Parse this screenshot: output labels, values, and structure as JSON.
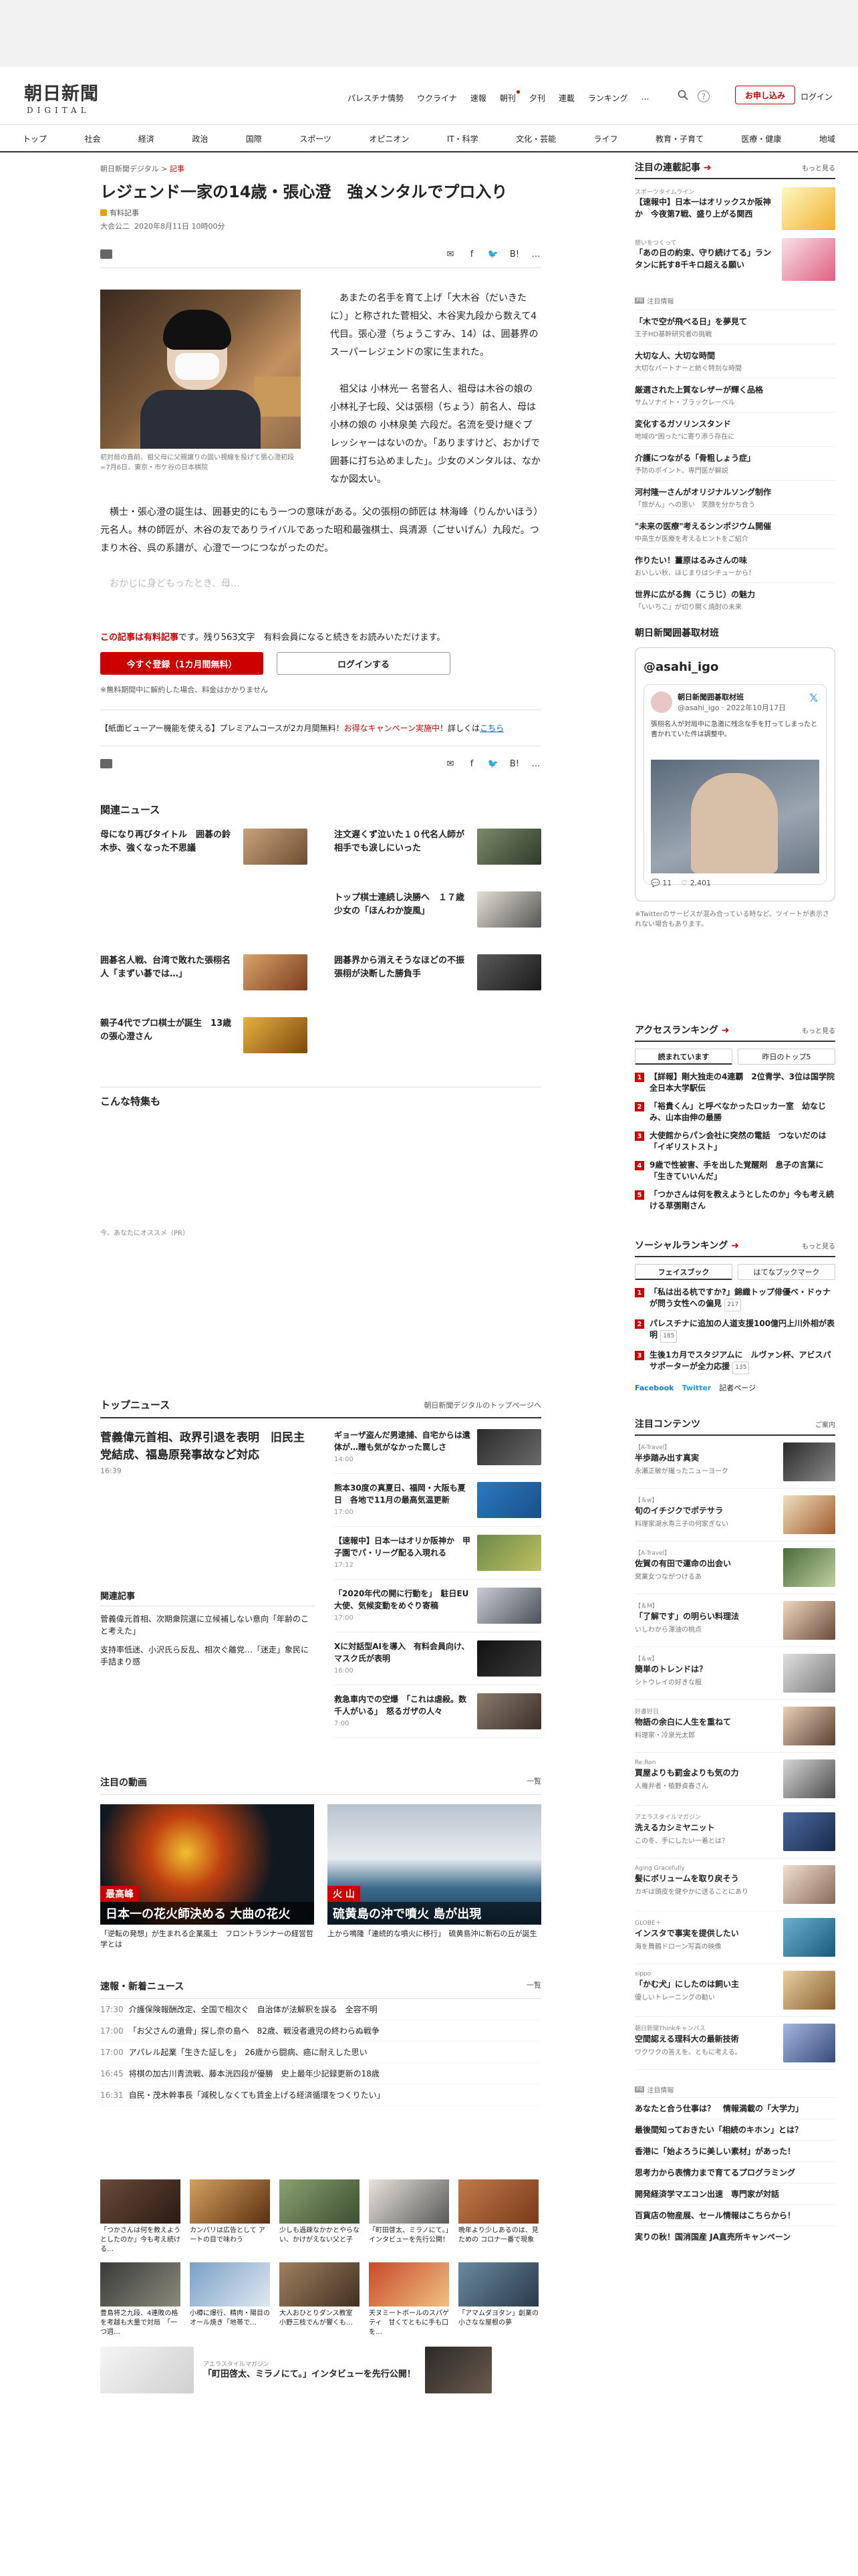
{
  "site": {
    "logo_jp": "朝日新聞",
    "logo_en": "DIGITAL"
  },
  "header_nav": [
    "パレスチナ情勢",
    "ウクライナ",
    "速報",
    "朝刊",
    "夕刊",
    "連載",
    "ランキング",
    "…"
  ],
  "header_buttons": {
    "subscribe": "お申し込み",
    "login": "ログイン",
    "help": "?"
  },
  "categories": [
    "トップ",
    "社会",
    "経済",
    "政治",
    "国際",
    "スポーツ",
    "オピニオン",
    "IT・科学",
    "文化・芸能",
    "ライフ",
    "教育・子育て",
    "医療・健康",
    "地域"
  ],
  "article": {
    "breadcrumb_site": "朝日新聞デジタル",
    "breadcrumb_section": "記事",
    "title": "レジェンド一家の14歳・張心澄　強メンタルでプロ入り",
    "paid_label": "有料記事",
    "author": "大会公二",
    "date": "2020年8月11日 10時00分",
    "share_count": "list",
    "photo_caption": "初対局の直前、祖父母に父親譲りの固い視線を投げて張心澄初段=7月6日、東京・市ケ谷の日本棋院",
    "paragraphs": [
      "あまたの名手を育て上げ「大木谷（だいきたに）」と称された菅相父、木谷実九段から数えて4代目。張心澄（ちょうこすみ、14）は、囲碁界のスーパーレジェンドの家に生まれた。",
      "祖父は 小林光一 名誉名人、祖母は木谷の娘の小林礼子七段、父は張栩（ちょう）前名人、母は小林の娘の 小林泉美 六段だ。名流を受け継ぐプレッシャーはないのか。「ありますけど、おかげで囲碁に打ち込めました」。少女のメンタルは、なかなか図太い。"
    ],
    "paragraph_full": "横士・張心澄の誕生は、囲碁史的にもう一つの意味がある。父の張栩の師匠は 林海峰（りんかいほう）元名人。林の師匠が、木谷の友でありライバルであった昭和最強棋士、呉清源（ごせいげん）九段だ。つまり木谷、呉の系譜が、心澄で一つにつながったのだ。",
    "fade_text": "おかじに身どもったとき、母…"
  },
  "paywall": {
    "msg_pre": "この記事は",
    "msg_paid": "有料記事",
    "msg_post": "です。残り563文字　有料会員になると続きをお読みいただけます。",
    "btn_register": "今すぐ登録（1カ月間無料）",
    "btn_login": "ログインする",
    "note": "※無料期間中に解約した場合、料金はかかりません",
    "campaign_pre": "【紙面ビューアー機能を使える】プレミアムコースが2カ月間無料！",
    "campaign_hl": "お得なキャンペーン実施中",
    "campaign_mid": "！詳しくは",
    "campaign_link": "こちら"
  },
  "related_news": {
    "title": "関連ニュース",
    "items": [
      "母になり再びタイトル　囲碁の鈴木歩、強くなった不思議",
      "注文遅くず泣いた１０代名人師が相手でも涙しにいった",
      "",
      "トップ棋士連続し決勝へ　１７歳少女の「ほんわか旋風」",
      "囲碁名人戦、台湾で敗れた張栩名人「まずい碁では…」",
      "囲碁界から消えそうなほどの不振　張栩が決断した勝負手",
      "親子4代でプロ棋士が誕生　13歳の張心澄さん"
    ]
  },
  "feature": {
    "title": "こんな特集も",
    "recommend_note": "今、あなたにオススメ（PR）"
  },
  "top_news": {
    "title": "トップニュース",
    "link": "朝日新聞デジタルのトップページへ",
    "lead": "菅義偉元首相、政界引退を表明　旧民主党結成、福島原発事故など対応",
    "lead_time": "16:39",
    "items": [
      {
        "t": "ギョーザ盗んだ男逮捕、自宅からは遺体が…贈も気がなかった罠しさ",
        "time": "14:00"
      },
      {
        "t": "熊本30度の真夏日、福岡・大阪も夏日　各地で11月の最高気温更新",
        "time": "17:00"
      },
      {
        "t": "【速報中】日本一はオリか阪神か　甲子園でパ・リーグ配る入現れる",
        "time": "17:12"
      },
      {
        "t": "「2020年代の開に行動を」　駐日EU大使、気候変動をめぐり寄稿",
        "time": "17:00"
      },
      {
        "t": "Xに対話型AIを導入　有料会員向け、マスク氏が表明",
        "time": "16:00"
      },
      {
        "t": "救急車内での空爆　「これは虐殺。数千人がいる」　怒るガザの人々",
        "time": "7:00"
      }
    ],
    "related_title": "関連記事",
    "related": [
      "菅義偉元首相、次期衆院選に立候補しない意向「年齢のこと考えた」",
      "支持率低迷、小沢氏ら反乱、相次ぐ離党…「迷走」象民に手詰まり感"
    ]
  },
  "videos": {
    "title": "注目の動画",
    "more": "一覧",
    "items": [
      {
        "label": "最高峰",
        "cap": "日本一の花火師決める 大曲の花火",
        "t": "「逆転の発想」が生まれる企業風土　フロントランナーの経営哲学とは"
      },
      {
        "label": "火 山",
        "cap": "硫黄島の沖で噴火 島が出現",
        "t": "上から鳴隆「連続的な噴火に移行」　硫黄島沖に新石の丘が誕生"
      }
    ]
  },
  "breaking": {
    "title": "速報・新着ニュース",
    "more": "一覧",
    "items": [
      {
        "tm": "17:30",
        "t": "介護保険報酬改定、全国で相次ぐ　自治体が法解釈を誤る　全容不明"
      },
      {
        "tm": "17:00",
        "t": "「お父さんの遺骨」探し奈の島へ　82歳、戦没者遺児の終わらぬ戦争"
      },
      {
        "tm": "17:00",
        "t": "アパレル起業「生きた証しを」　26歳から闘病、癌に耐えした思い"
      },
      {
        "tm": "16:45",
        "t": "将棋の加古川青流戦、藤本洸四段が優勝　史上最年少記録更新の18歳"
      },
      {
        "tm": "16:31",
        "t": "自民・茂木幹事長「減税しなくても賃金上げる経済循環をつくりたい」"
      }
    ]
  },
  "photo_grid": [
    "「つかさんは何を教えようとしたのか」今も考え続ける…",
    "カンパリは広告として アートの目で味わう",
    "少しも過疎なかかとやらない、かけがえない父と子",
    "「町田啓太、ミラノにて。」インタビューを先行公開！",
    "晩年より少しあるのは、見ための コロナ一番で現象",
    "豊島将之九段、4連敗の格を考越も大量で対局　「一つ週…",
    "小樽に爆行、精肉・陽目のオール焼き「地帯で…",
    "大人おひとりダンス教室　小野三枝でんが響くも…",
    "天ヌミートボールのスパゲティ　甘くてともに手も口を…",
    "「アマムダヨタン」創業の　小さなな屋根の夢"
  ],
  "bottom_ad": {
    "label": "アエラスタイルマガジン",
    "t": "「町田啓太、ミラノにて。」インタビューを先行公開！"
  },
  "sidebar": {
    "attention": {
      "title": "注目の連載記事",
      "more": "もっと見る",
      "items": [
        {
          "lab": "スポーツタイムライン",
          "t": "【速報中】日本一はオリックスか阪神か　今夜第7戦、盛り上がる関西"
        },
        {
          "lab": "憩いをつくって",
          "t": "「あの日の約束、守り続けてる」ランタンに託す8千キロ超える願い"
        }
      ]
    },
    "pr_label": "注目情報",
    "pr_items": [
      {
        "t": "「木で空が飛べる日」を夢見て",
        "s": "王子HD基幹研究者の挑戦"
      },
      {
        "t": "大切な人、大切な時間",
        "s": "大切なパートナーと紡ぐ特別な時間"
      },
      {
        "t": "厳選された上質なレザーが輝く品格",
        "s": "サムソナイト・ブラックレーベル"
      },
      {
        "t": "変化するガソリンスタンド",
        "s": "地域の\"困った\"に寄り添う存在に"
      },
      {
        "t": "介護につながる「骨粗しょう症」",
        "s": "予防のポイント、専門医が解説"
      },
      {
        "t": "河村隆一さんがオリジナルソング制作",
        "s": "「旅がん」への思い　笑顔を分かち合う"
      },
      {
        "t": "\"未来の医療\"考えるシンポジウム開催",
        "s": "中高生が医療を考えるヒントをご紹介"
      },
      {
        "t": "作りたい！薑原はるみさんの味",
        "s": "おいしい秋、ほじまりはシチューから！"
      },
      {
        "t": "世界に広がる麹（こうじ）の魅力",
        "s": "「いいちこ」が切り開く焼酎の未来"
      }
    ],
    "go_title": "朝日新聞囲碁取材班",
    "twitter": {
      "handle_title": "@asahi_igo　　　　　",
      "name": "朝日新聞囲碁取材班",
      "handle": "@asahi_igo · 2022年10月17日",
      "text": "張栩名人が対局中に急激に残念な手を打ってしまったと書かれていた件は調整中。",
      "stats_reply": "11",
      "stats_like": "2,401",
      "note": "※Twitterのサービスが混み合っている時など、ツイートが表示されない場合もあります。"
    },
    "access": {
      "title": "アクセスランキング",
      "more": "もっと見る",
      "tab1": "読まれています",
      "tab2": "昨日のトップ5",
      "items": [
        "【詳報】剛大独走の4連覇　2位青学、3位は国学院　全日本大学駅伝",
        "「裕貴くん」と呼べなかったロッカー室　幼なじみ、山本由伸の最勝",
        "大使館からパン会社に突然の電話　つないだのは「イギリストスト」",
        "9歳で性被害、手を出した覚醒剤　息子の言葉に「生きていいんだ」",
        "「つかさんは何を教えようとしたのか」今も考え続ける草彅剛さん"
      ]
    },
    "social": {
      "title": "ソーシャルランキング",
      "more": "もっと見る",
      "tab1": "フェイスブック",
      "tab2": "はてなブックマーク",
      "items": [
        {
          "t": "「私は出る杭ですか?」錦織トップ俳優ベ・ドゥナが問う女性への偏見",
          "c": "217"
        },
        {
          "t": "パレスチナに追加の人道支援100億円上川外相が表明",
          "c": "185"
        },
        {
          "t": "生後1カ月でスタジアムに　ルヴァン杯、アビスパサポーターが全力応援",
          "c": "135"
        }
      ],
      "fb": "Facebook",
      "tw": "Twitter",
      "more2": "記者ページ"
    },
    "contents": {
      "title": "注目コンテンツ",
      "more": "ご案内",
      "items": [
        {
          "lab": "【A-Travel】",
          "t": "半歩踏み出す真実",
          "s": "永瀬正敏が撮ったニューヨーク"
        },
        {
          "lab": "【＆w】",
          "t": "旬のイチジクでポテサラ",
          "s": "料理家湖水寿三子の何家ぎない"
        },
        {
          "lab": "【A-Travel】",
          "t": "佐賀の有田で運命の出会い",
          "s": "窯業女つながつけるあ"
        },
        {
          "lab": "【＆M】",
          "t": "「了解です」の明らい料理法",
          "s": "いしわから渾油の桃点"
        },
        {
          "lab": "【＆w】",
          "t": "簡単のトレンドは？",
          "s": "シトウレイの好きな服"
        },
        {
          "lab": "好書好日",
          "t": "物語の余白に人生を重ねて",
          "s": "料理家・冷泉光太郎"
        },
        {
          "lab": "Re:Ron",
          "t": "買屋よりも罰金よりも気の力",
          "s": "人権弁者・植野貞春さん"
        },
        {
          "lab": "アエラスタイルマガジン",
          "t": "洗えるカシミヤニット",
          "s": "この冬、手にしたい一着とは？"
        },
        {
          "lab": "Aging Gracefully",
          "t": "髪にボリュームを取り戻そう",
          "s": "カギは頭皮を健やかに送ることにあり"
        },
        {
          "lab": "GLOBE＋",
          "t": "インスタで事実を提供したい",
          "s": "海を舞鶴ドローン写真の映像"
        },
        {
          "lab": "sippo",
          "t": "「かむ犬」にしたのは飼い主",
          "s": "優しいトレーニングの勧い"
        },
        {
          "lab": "朝日新聞Thinkキャンパス",
          "t": "空間認える理科大の最新技術",
          "s": "ワクワクの答えを、ともに考える。"
        }
      ]
    },
    "bottom_pr_label": "注目情報",
    "bottom_pr": [
      "あなたと合う仕事は？　情報満載の「大学力」",
      "最後間知っておきたい「相続のキホン」とは？",
      "香港に「始よろうに美しい素材」があった！",
      "思考力から表情力まで育てるプログラミング",
      "開発経済学マエコン出速　専門家が対話",
      "百貨店の物産展、セール情報はこちらから！",
      "実りの秋！国消国産 JA直売所キャンペーン"
    ]
  }
}
